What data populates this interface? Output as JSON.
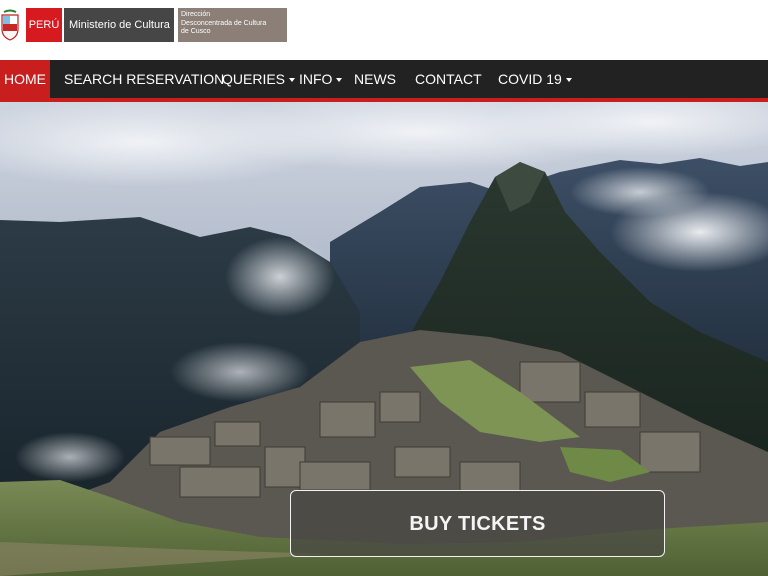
{
  "header": {
    "peru_label": "PERÚ",
    "ministry_label": "Ministerio de Cultura",
    "directorate_lines": [
      "Dirección",
      "Desconcentrada de Cultura",
      "de Cusco"
    ],
    "colors": {
      "peru_red": "#d71920",
      "ministry_gray": "#464646",
      "directorate_taupe": "#8b7f78"
    }
  },
  "nav": {
    "items": [
      {
        "label": "HOME",
        "active": true,
        "dropdown": false
      },
      {
        "label": "SEARCH RESERVATION",
        "active": false,
        "dropdown": false
      },
      {
        "label": "QUERIES",
        "active": false,
        "dropdown": true
      },
      {
        "label": "INFO",
        "active": false,
        "dropdown": true
      },
      {
        "label": "NEWS",
        "active": false,
        "dropdown": false
      },
      {
        "label": "CONTACT",
        "active": false,
        "dropdown": false
      },
      {
        "label": "COVID 19",
        "active": false,
        "dropdown": true
      }
    ],
    "colors": {
      "background": "#222222",
      "active": "#c81e1e",
      "accent_line": "#c81e1e"
    }
  },
  "hero": {
    "cta_label": "BUY TICKETS"
  }
}
